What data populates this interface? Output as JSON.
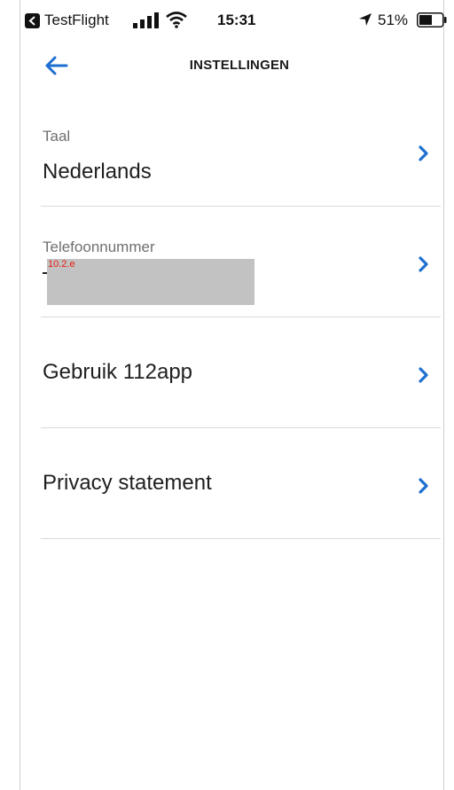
{
  "status_bar": {
    "back_app_label": "TestFlight",
    "time": "15:31",
    "battery_percent": "51%",
    "icons": [
      "back-app-icon",
      "signal-icon",
      "wifi-icon",
      "location-icon",
      "battery-icon"
    ]
  },
  "nav": {
    "title": "INSTELLINGEN",
    "back_icon": "arrow-left-icon"
  },
  "settings": {
    "language": {
      "label": "Taal",
      "value": "Nederlands"
    },
    "phone": {
      "label": "Telefoonnummer",
      "redaction_tag": "10.2.e"
    },
    "usage": {
      "title": "Gebruik 112app"
    },
    "privacy": {
      "title": "Privacy statement"
    },
    "chevron_icon": "chevron-right-icon"
  },
  "colors": {
    "accent": "#1e6fd0",
    "text_primary": "#1f1f1f",
    "text_secondary": "#6f6f6f",
    "divider": "#d9d9d9",
    "redaction": "#c2c2c2",
    "redaction_tag": "#e8190f"
  }
}
